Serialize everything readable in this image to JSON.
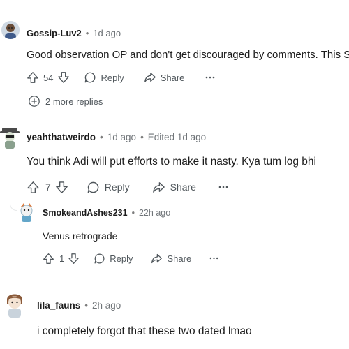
{
  "comments": [
    {
      "username": "Gossip-Luv2",
      "time": "1d ago",
      "body": "Good observation OP and don't get discouraged by comments. This Su",
      "votes": "54",
      "reply_label": "Reply",
      "share_label": "Share",
      "more_replies": "2 more replies"
    },
    {
      "username": "yeahthatweirdo",
      "time": "1d ago",
      "edited": "Edited 1d ago",
      "body": "You think Adi will put efforts to make it nasty. Kya tum log bhi",
      "votes": "7",
      "reply_label": "Reply",
      "share_label": "Share"
    },
    {
      "username": "SmokeandAshes231",
      "time": "22h ago",
      "body": "Venus retrograde",
      "votes": "1",
      "reply_label": "Reply",
      "share_label": "Share"
    },
    {
      "username": "lila_fauns",
      "time": "2h ago",
      "body": "i completely forgot that these two dated lmao"
    }
  ],
  "icons": {
    "upvote": "upvote-icon",
    "downvote": "downvote-icon",
    "reply": "reply-bubble-icon",
    "share": "share-icon",
    "overflow": "overflow-menu-icon",
    "expand": "plus-circle-icon"
  },
  "colors": {
    "text": "#1c1c1c",
    "meta": "#6f7478",
    "action": "#4f565b",
    "thread_line": "#e7e9ea"
  }
}
